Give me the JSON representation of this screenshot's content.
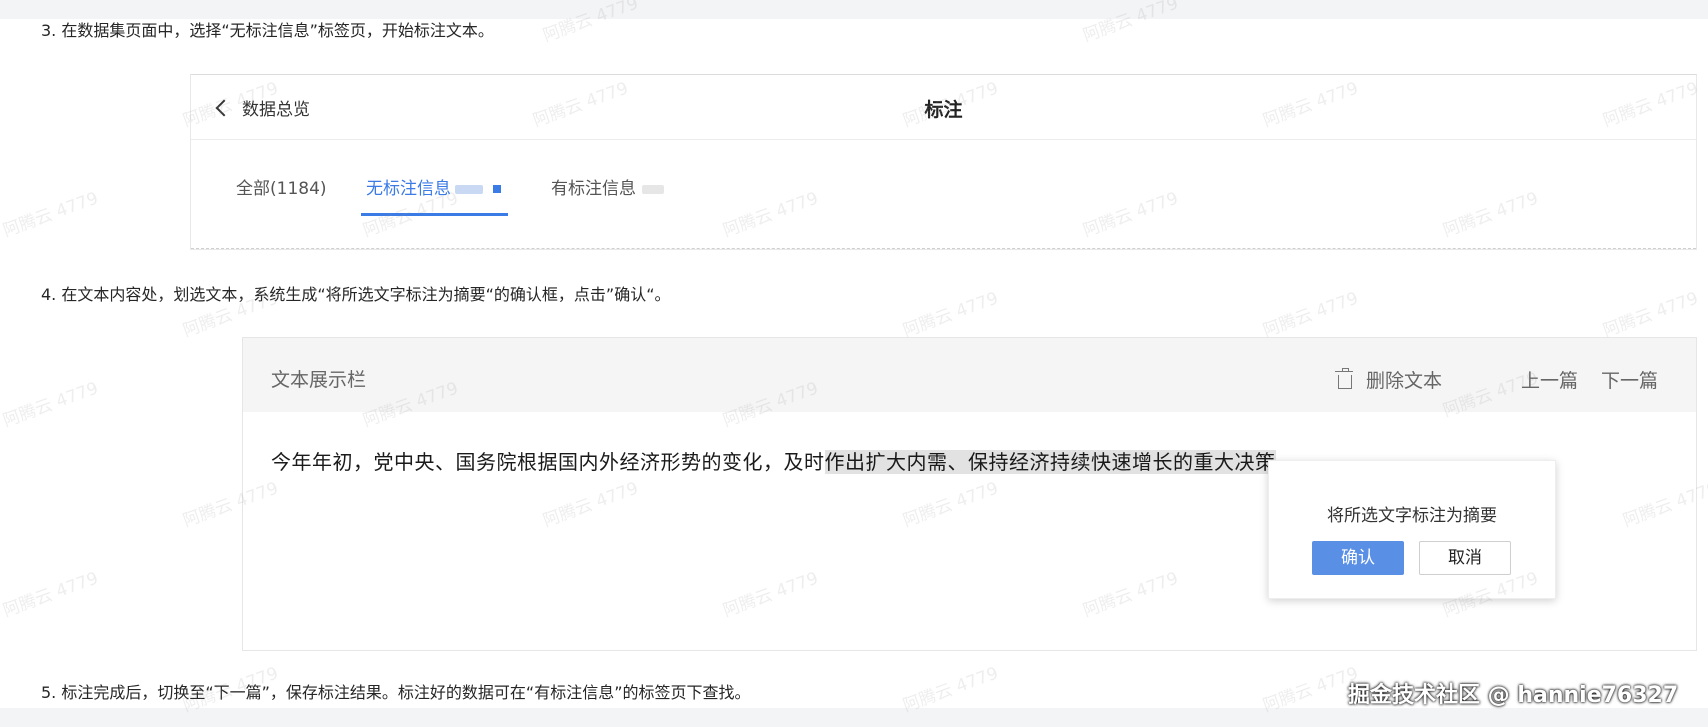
{
  "steps": {
    "step3": "3. 在数据集页面中，选择“无标注信息”标签页，开始标注文本。",
    "step4": "4. 在文本内容处，划选文本，系统生成“将所选文字标注为摘要“的确认框，点击”确认“。",
    "step5": "5. 标注完成后，切换至“下一篇”，保存标注结果。标注好的数据可在“有标注信息”的标签页下查找。"
  },
  "panel1": {
    "back_label": "数据总览",
    "title": "标注",
    "tabs": [
      {
        "label": "全部(1184)"
      },
      {
        "label": "无标注信息"
      },
      {
        "label": "有标注信息"
      }
    ]
  },
  "panel2": {
    "title": "文本展示栏",
    "delete_label": "删除文本",
    "prev_label": "上一篇",
    "next_label": "下一篇",
    "text_before": "今年年初，党中央、国务院根据国内外经济形势的变化，及时",
    "text_selected": "作出扩大内需、保持经济持续快速增长的重大决策"
  },
  "popup": {
    "message": "将所选文字标注为摘要",
    "confirm_label": "确认",
    "cancel_label": "取消"
  },
  "watermark": "阿腾云 4779",
  "brand": "掘金技术社区 @ hannie76327",
  "colors": {
    "accent": "#3b7be6",
    "confirm_button": "#5a8fe6",
    "selection": "#e2e2e2"
  }
}
